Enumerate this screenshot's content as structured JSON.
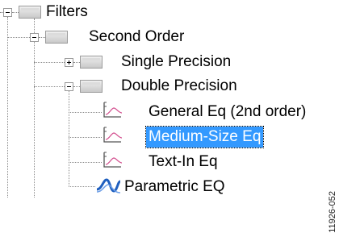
{
  "tree": {
    "nodes": [
      {
        "label": "Filters",
        "expanded": true
      },
      {
        "label": "Second Order",
        "expanded": true
      },
      {
        "label": "Single Precision",
        "expanded": false
      },
      {
        "label": "Double Precision",
        "expanded": true
      },
      {
        "label": "General Eq (2nd order)"
      },
      {
        "label": "Medium-Size Eq",
        "selected": true
      },
      {
        "label": "Text-In Eq"
      },
      {
        "label": "Parametric EQ"
      }
    ]
  },
  "figure_code": "11926-052",
  "colors": {
    "selection": "#3399ff",
    "tree_line": "#8a8a8a",
    "chart_icon": "#d24b8c",
    "param_icon": "#1f5fbf"
  }
}
